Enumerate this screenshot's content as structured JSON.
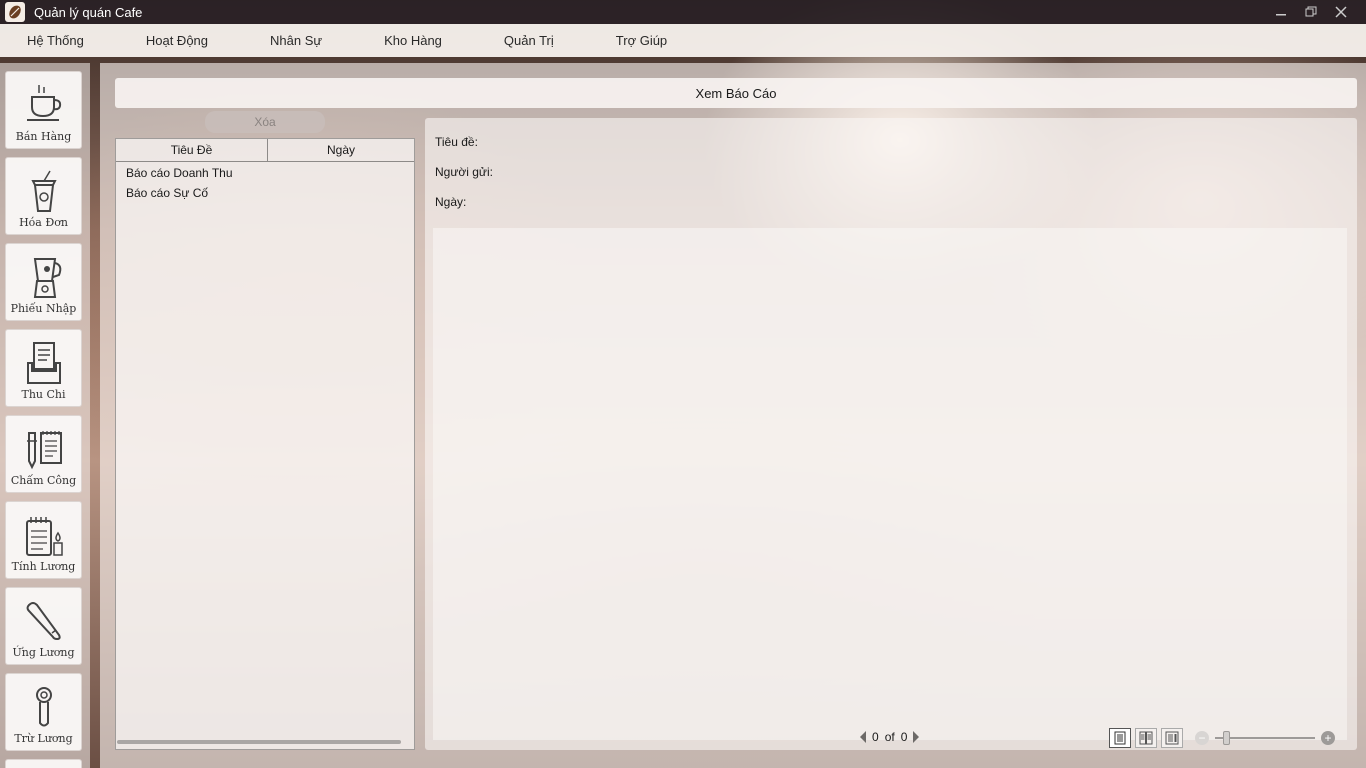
{
  "window": {
    "title": "Quản lý quán Cafe"
  },
  "menu": [
    "Hệ Thống",
    "Hoạt Động",
    "Nhân Sự",
    "Kho Hàng",
    "Quản Trị",
    "Trợ Giúp"
  ],
  "sidebar": [
    {
      "label": "Bán Hàng",
      "icon": "coffee-cup-icon"
    },
    {
      "label": "Hóa Đơn",
      "icon": "takeaway-cup-icon"
    },
    {
      "label": "Phiếu Nhập",
      "icon": "blender-icon"
    },
    {
      "label": "Thu Chi",
      "icon": "document-tray-icon"
    },
    {
      "label": "Chấm Công",
      "icon": "pen-notebook-icon"
    },
    {
      "label": "Tính Lương",
      "icon": "notepad-icon"
    },
    {
      "label": "Ứng Lương",
      "icon": "baseball-bat-icon"
    },
    {
      "label": "Trừ Lương",
      "icon": "portafilter-icon"
    }
  ],
  "report": {
    "header": "Xem Báo Cáo",
    "delete_label": "Xóa",
    "columns": [
      "Tiêu Đề",
      "Ngày"
    ],
    "rows": [
      {
        "title": "Báo cáo Doanh Thu",
        "date": ""
      },
      {
        "title": "Báo cáo Sự Cố",
        "date": ""
      }
    ],
    "fields": {
      "title_label": "Tiêu đề:",
      "sender_label": "Người gửi:",
      "date_label": "Ngày:"
    },
    "pager": {
      "current": "0",
      "of": "of",
      "total": "0"
    }
  }
}
